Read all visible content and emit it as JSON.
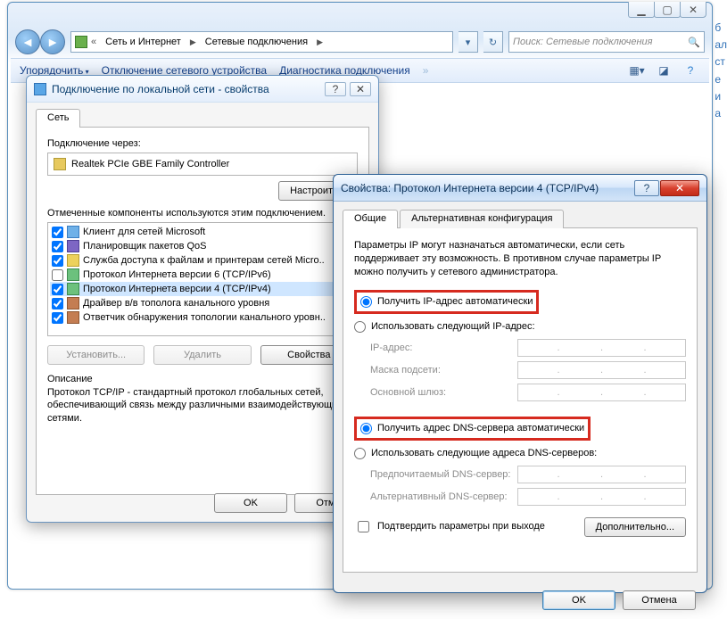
{
  "explorer": {
    "crumb1": "Сеть и Интернет",
    "crumb2": "Сетевые подключения",
    "search_placeholder": "Поиск: Сетевые подключения",
    "cmd_organize": "Упорядочить",
    "cmd_disable": "Отключение сетевого устройства",
    "cmd_diag": "Диагностика подключения"
  },
  "dlg1": {
    "title": "Подключение по локальной сети - свойства",
    "tab_net": "Сеть",
    "conn_via": "Подключение через:",
    "adapter": "Realtek PCIe GBE Family Controller",
    "btn_configure": "Настроить...",
    "list_caption": "Отмеченные компоненты используются этим подключением.",
    "items": [
      {
        "label": "Клиент для сетей Microsoft",
        "checked": true,
        "icon": "client"
      },
      {
        "label": "Планировщик пакетов QoS",
        "checked": true,
        "icon": "sched"
      },
      {
        "label": "Служба доступа к файлам и принтерам сетей Micro..",
        "checked": true,
        "icon": "share"
      },
      {
        "label": "Протокол Интернета версии 6 (TCP/IPv6)",
        "checked": false,
        "icon": "proto"
      },
      {
        "label": "Протокол Интернета версии 4 (TCP/IPv4)",
        "checked": true,
        "icon": "proto",
        "selected": true
      },
      {
        "label": "Драйвер в/в тополога канального уровня",
        "checked": true,
        "icon": "drv"
      },
      {
        "label": "Ответчик обнаружения топологии канального уровн..",
        "checked": true,
        "icon": "drv"
      }
    ],
    "btn_install": "Установить...",
    "btn_remove": "Удалить",
    "btn_props": "Свойства",
    "desc_head": "Описание",
    "desc": "Протокол TCP/IP - стандартный протокол глобальных сетей, обеспечивающий связь между различными взаимодействующими сетями.",
    "ok": "OK",
    "cancel": "Отмен"
  },
  "dlg2": {
    "title": "Свойства: Протокол Интернета версии 4 (TCP/IPv4)",
    "tab_general": "Общие",
    "tab_alt": "Альтернативная конфигурация",
    "intro": "Параметры IP могут назначаться автоматически, если сеть поддерживает эту возможность. В противном случае параметры IP можно получить у сетевого администратора.",
    "ip_auto": "Получить IP-адрес автоматически",
    "ip_manual": "Использовать следующий IP-адрес:",
    "f_ip": "IP-адрес:",
    "f_mask": "Маска подсети:",
    "f_gw": "Основной шлюз:",
    "dns_auto": "Получить адрес DNS-сервера автоматически",
    "dns_manual": "Использовать следующие адреса DNS-серверов:",
    "f_dns1": "Предпочитаемый DNS-сервер:",
    "f_dns2": "Альтернативный DNS-сервер:",
    "validate": "Подтвердить параметры при выходе",
    "advanced": "Дополнительно...",
    "ok": "OK",
    "cancel": "Отмена"
  }
}
